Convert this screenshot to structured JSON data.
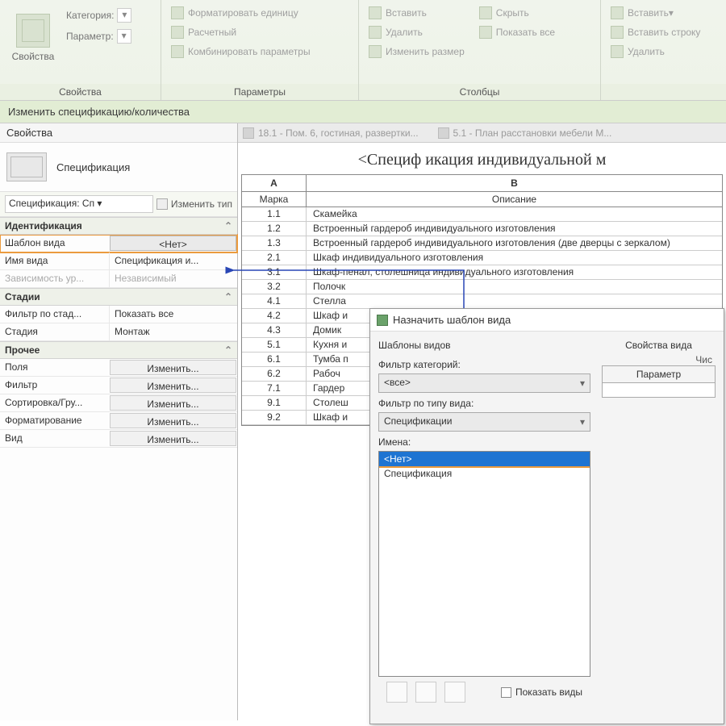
{
  "ribbon": {
    "g1": {
      "big_label": "Свойства",
      "cat_label": "Категория:",
      "param_label": "Параметр:",
      "title": "Свойства"
    },
    "g2": {
      "b1": "Форматировать единицу",
      "b2": "Расчетный",
      "b3": "Комбинировать параметры",
      "title": "Параметры"
    },
    "g3": {
      "b1": "Вставить",
      "b2": "Удалить",
      "b3": "Изменить размер",
      "b4": "Скрыть",
      "b5": "Показать все",
      "title": "Столбцы"
    },
    "g4": {
      "b1": "Вставить",
      "b2": "Вставить строку",
      "b3": "Удалить"
    }
  },
  "green_bar": "Изменить спецификацию/количества",
  "props": {
    "panel_title": "Свойства",
    "type_label": "Спецификация",
    "instance_sel": "Спецификация: Сп",
    "edit_type": "Изменить тип",
    "sections": {
      "ident": "Идентификация",
      "stages": "Стадии",
      "other": "Прочее"
    },
    "rows": {
      "template_k": "Шаблон вида",
      "template_v": "<Нет>",
      "name_k": "Имя вида",
      "name_v": "Спецификация и...",
      "dep_k": "Зависимость ур...",
      "dep_v": "Независимый",
      "filter_k": "Фильтр по стад...",
      "filter_v": "Показать все",
      "stage_k": "Стадия",
      "stage_v": "Монтаж",
      "fields_k": "Поля",
      "fields_v": "Изменить...",
      "flt_k": "Фильтр",
      "flt_v": "Изменить...",
      "sort_k": "Сортировка/Гру...",
      "sort_v": "Изменить...",
      "fmt_k": "Форматирование",
      "fmt_v": "Изменить...",
      "view_k": "Вид",
      "view_v": "Изменить..."
    }
  },
  "tabs": {
    "t1": "18.1 - Пом. 6, гостиная, развертки...",
    "t2": "5.1 - План расстановки мебели М..."
  },
  "doc_title": "<Специф икация индивидуальной м",
  "sched": {
    "colA": "A",
    "colB": "B",
    "hA": "Марка",
    "hB": "Описание",
    "rows": [
      {
        "a": "1.1",
        "b": "Скамейка"
      },
      {
        "a": "1.2",
        "b": "Встроенный гардероб индивидуального изготовления"
      },
      {
        "a": "1.3",
        "b": "Встроенный гардероб индивидуального изготовления (две дверцы с зеркалом)"
      },
      {
        "a": "2.1",
        "b": "Шкаф индивидуального изготовления"
      },
      {
        "a": "3.1",
        "b": "Шкаф-пенал, столешница индивидуального изготовления"
      },
      {
        "a": "3.2",
        "b": "Полочк"
      },
      {
        "a": "4.1",
        "b": "Стелла"
      },
      {
        "a": "4.2",
        "b": "Шкаф и"
      },
      {
        "a": "4.3",
        "b": "Домик"
      },
      {
        "a": "5.1",
        "b": "Кухня и"
      },
      {
        "a": "6.1",
        "b": "Тумба п"
      },
      {
        "a": "6.2",
        "b": "Рабоч"
      },
      {
        "a": "7.1",
        "b": "Гардер"
      },
      {
        "a": "9.1",
        "b": "Столеш"
      },
      {
        "a": "9.2",
        "b": "Шкаф и"
      }
    ]
  },
  "dialog": {
    "title": "Назначить шаблон вида",
    "left_title": "Шаблоны видов",
    "cat_filter_label": "Фильтр категорий:",
    "cat_filter_value": "<все>",
    "type_filter_label": "Фильтр по типу вида:",
    "type_filter_value": "Спецификации",
    "names_label": "Имена:",
    "list": [
      "<Нет>",
      "Спецификация"
    ],
    "show_views": "Показать виды",
    "right_title": "Свойства вида",
    "right_sub": "Чис",
    "right_col": "Параметр"
  }
}
